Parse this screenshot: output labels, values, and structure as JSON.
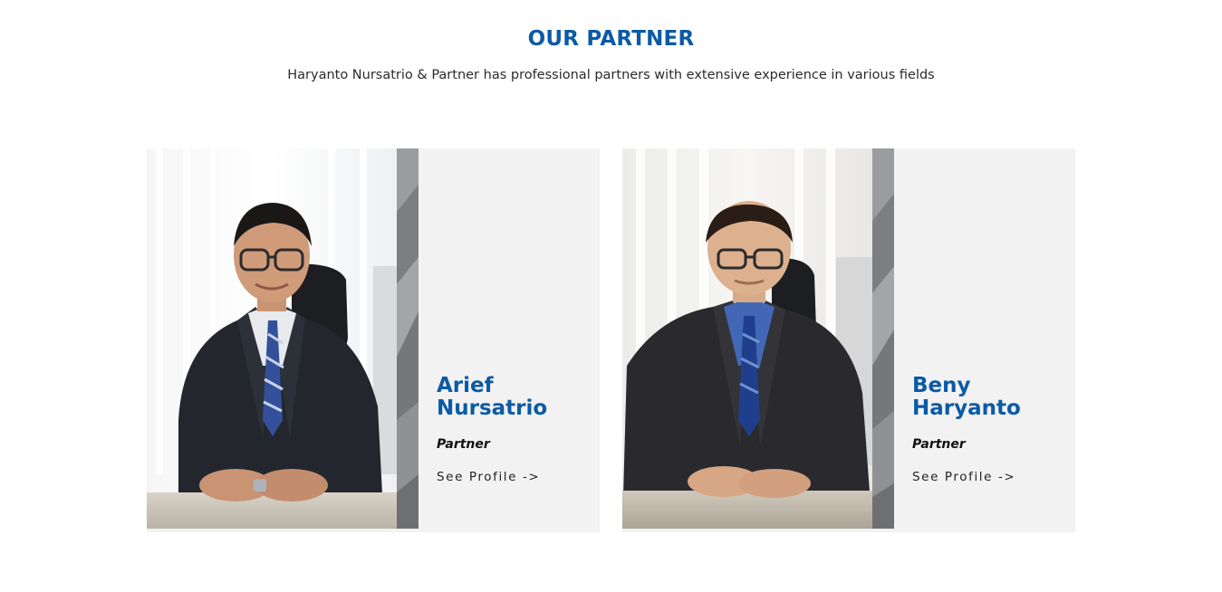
{
  "section": {
    "title": "OUR PARTNER",
    "subtitle": "Haryanto Nursatrio & Partner has professional partners with extensive experience in various fields"
  },
  "partners": [
    {
      "first_name": "Arief",
      "last_name": "Nursatrio",
      "role": "Partner",
      "link_label": "See Profile ->"
    },
    {
      "first_name": "Beny",
      "last_name": "Haryanto",
      "role": "Partner",
      "link_label": "See Profile ->"
    }
  ],
  "colors": {
    "accent": "#0b5aa6",
    "card_background": "#f2f2f2",
    "stripe": "#8a8b8f"
  }
}
